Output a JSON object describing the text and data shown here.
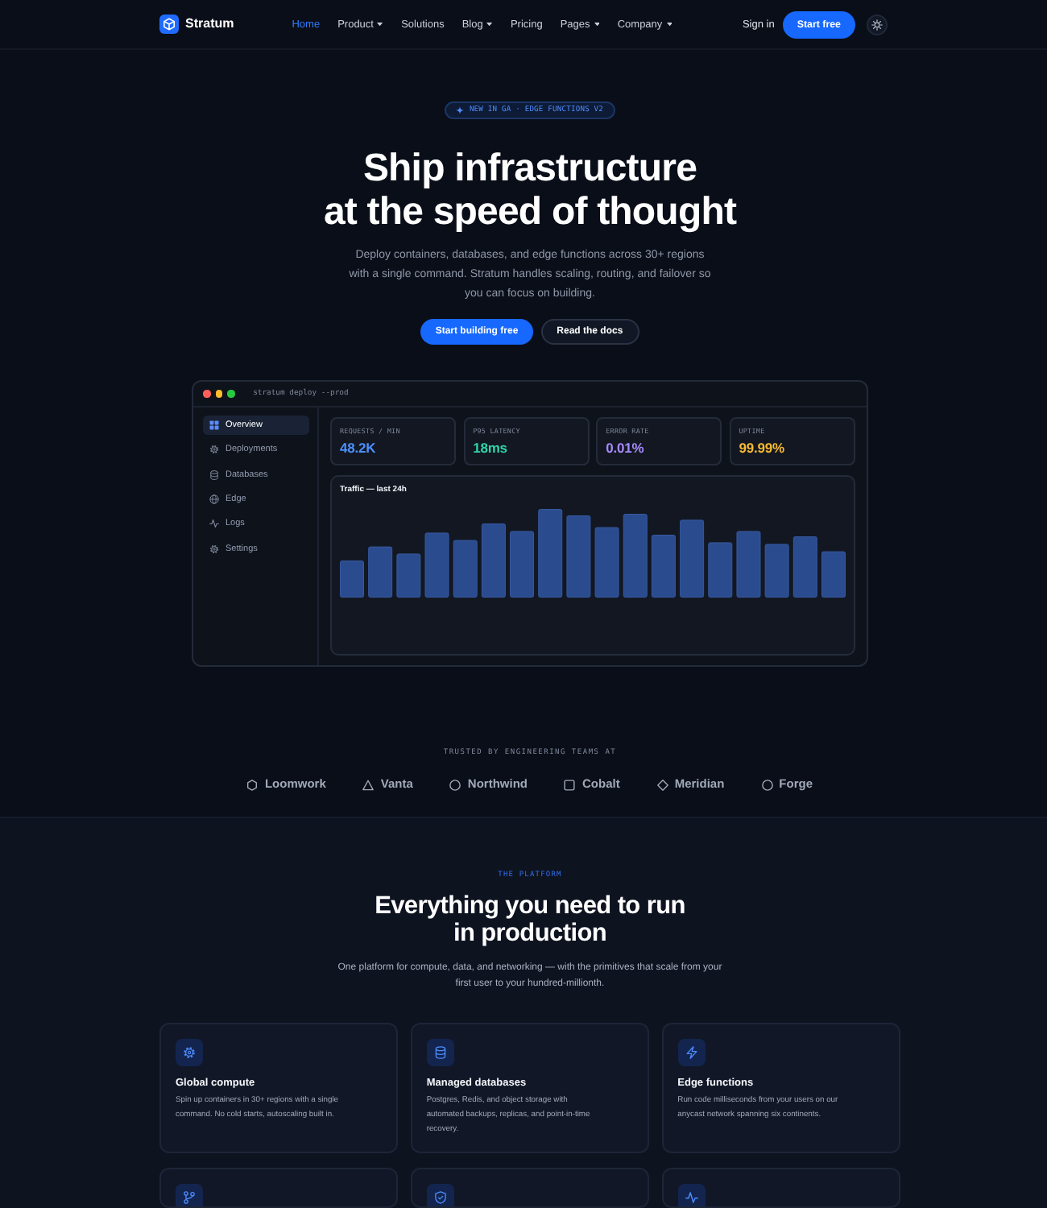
{
  "nav": {
    "brand": "Stratum",
    "links": [
      {
        "label": "Home",
        "selected": true,
        "dropdown": false
      },
      {
        "label": "Product",
        "selected": false,
        "dropdown": true
      },
      {
        "label": "Solutions",
        "selected": false,
        "dropdown": false
      },
      {
        "label": "Blog",
        "selected": false,
        "dropdown": true
      },
      {
        "label": "Pricing",
        "selected": false,
        "dropdown": false
      },
      {
        "label": "Pages",
        "selected": false,
        "dropdown": true
      },
      {
        "label": "Company",
        "selected": false,
        "dropdown": true
      }
    ],
    "sign_in": "Sign in",
    "cta": "Start free"
  },
  "hero": {
    "badge": "NEW IN GA · EDGE FUNCTIONS V2",
    "title": "Ship infrastructure\nat the speed of thought",
    "subtitle": "Deploy containers, databases, and edge functions across 30+ regions\nwith a single command. Stratum handles scaling, routing, and failover so\nyou can focus on building.",
    "buttons": [
      {
        "label": "Start building free",
        "kind": "primary"
      },
      {
        "label": "Read the docs",
        "kind": "secondary"
      }
    ]
  },
  "dashboard": {
    "command": "stratum deploy --prod",
    "sidebar": [
      {
        "label": "Overview",
        "selected": true
      },
      {
        "label": "Deployments",
        "selected": false
      },
      {
        "label": "Databases",
        "selected": false
      },
      {
        "label": "Edge",
        "selected": false
      },
      {
        "label": "Logs",
        "selected": false
      },
      {
        "label": "Settings",
        "selected": false
      }
    ],
    "stats": [
      {
        "label": "REQUESTS / MIN",
        "value": "48.2K",
        "color": "#4d8ef8"
      },
      {
        "label": "P95 LATENCY",
        "value": "18ms",
        "color": "#2fd3a7"
      },
      {
        "label": "ERROR RATE",
        "value": "0.01%",
        "color": "#a78bfa"
      },
      {
        "label": "UPTIME",
        "value": "99.99%",
        "color": "#f5b931"
      }
    ],
    "chart_title": "Traffic — last 24h"
  },
  "trusted": {
    "label": "TRUSTED BY ENGINEERING TEAMS AT",
    "logos": [
      "Loomwork",
      "Vanta",
      "Northwind",
      "Cobalt",
      "Meridian",
      "Forge"
    ]
  },
  "platform": {
    "eyebrow": "THE PLATFORM",
    "title": "Everything you need to run\nin production",
    "description": "One platform for compute, data, and networking — with the primitives that scale from your\nfirst user to your hundred-millionth.",
    "features": [
      {
        "kind": "compute",
        "title": "Global compute",
        "description": "Spin up containers in 30+ regions with a single\ncommand. No cold starts, autoscaling built in."
      },
      {
        "kind": "databases",
        "title": "Managed databases",
        "description": "Postgres, Redis, and object storage with\nautomated backups, replicas, and point-in-time\nrecovery."
      },
      {
        "kind": "edge",
        "title": "Edge functions",
        "description": "Run code milliseconds from your users on our\nanycast network spanning six continents."
      },
      {
        "kind": "branching"
      },
      {
        "kind": "security"
      },
      {
        "kind": "monitoring"
      }
    ]
  }
}
